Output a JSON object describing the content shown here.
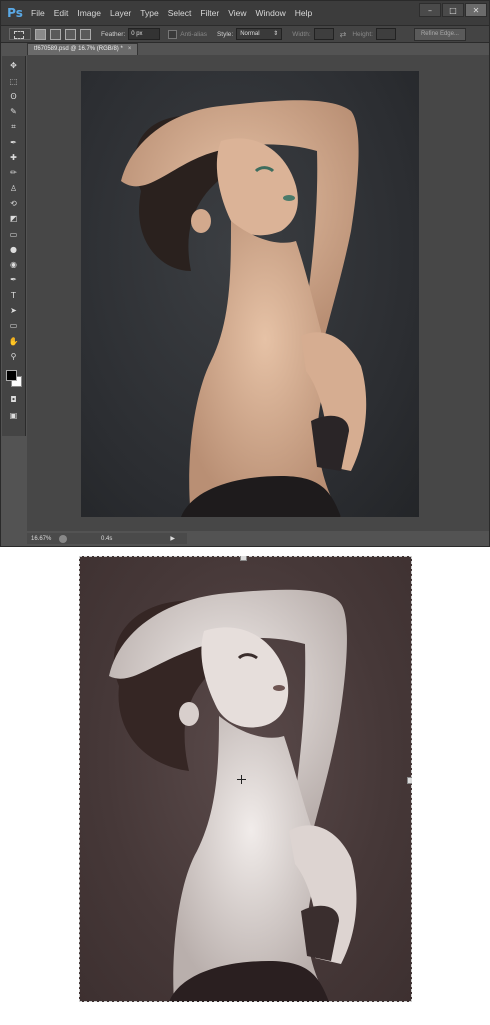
{
  "app": {
    "logo": "Ps",
    "menu": [
      "File",
      "Edit",
      "Image",
      "Layer",
      "Type",
      "Select",
      "Filter",
      "View",
      "Window",
      "Help"
    ],
    "window_controls": [
      "–",
      "□",
      "✕"
    ]
  },
  "options": {
    "feather_label": "Feather:",
    "feather_value": "0 px",
    "antialias_label": "Anti-alias",
    "style_label": "Style:",
    "style_value": "Normal",
    "width_label": "Width:",
    "height_label": "Height:",
    "refine_edge_label": "Refine Edge..."
  },
  "tools": [
    "move-tool",
    "marquee-tool",
    "lasso-tool",
    "quick-select-tool",
    "crop-tool",
    "eyedropper-tool",
    "healing-tool",
    "brush-tool",
    "stamp-tool",
    "history-brush-tool",
    "eraser-tool",
    "gradient-tool",
    "blur-tool",
    "dodge-tool",
    "pen-tool",
    "type-tool",
    "path-select-tool",
    "shape-tool",
    "hand-tool",
    "zoom-tool"
  ],
  "tool_glyphs": [
    "✥",
    "⬚",
    "ʘ",
    "✎",
    "⌗",
    "✒",
    "✚",
    "✏",
    "♙",
    "⟲",
    "◩",
    "▭",
    "●",
    "◉",
    "✒",
    "T",
    "➤",
    "▭",
    "✋",
    "⚲"
  ],
  "document": {
    "tab_title": "tf670589.psd @ 16.7% (RGB/8) *",
    "tab_close": "×"
  },
  "status": {
    "zoom": "16.67%",
    "info": "0.4s",
    "arrow": "▶"
  },
  "colors": {
    "foreground": "#000000",
    "background": "#ffffff",
    "canvas_bg": "#2b2d31",
    "result_bg": "#463838"
  }
}
